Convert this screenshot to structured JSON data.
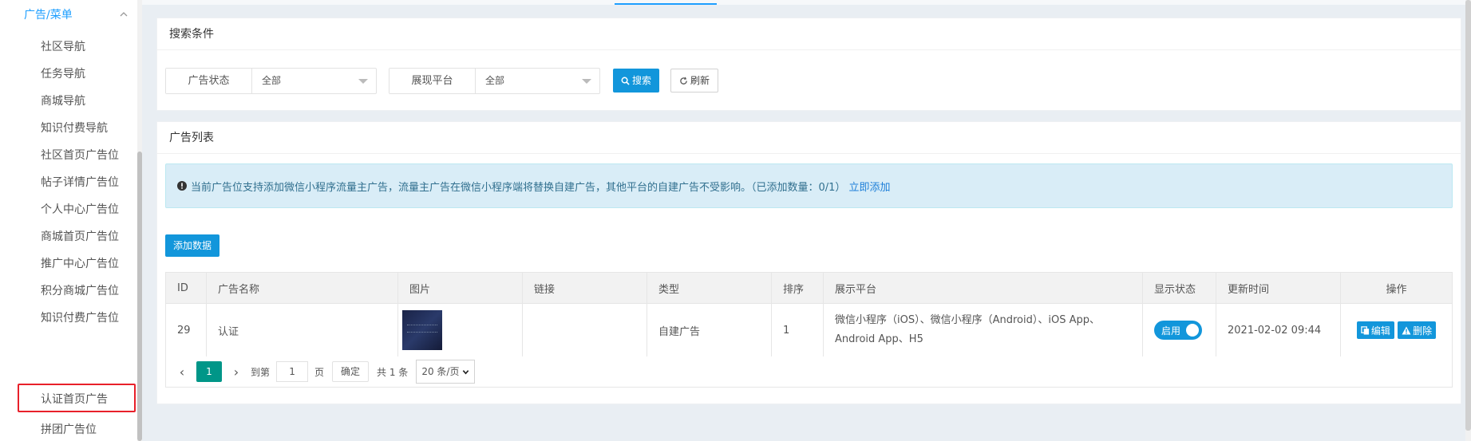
{
  "sidebar": {
    "group_title": "广告/菜单",
    "items": [
      {
        "label": "社区导航"
      },
      {
        "label": "任务导航"
      },
      {
        "label": "商城导航"
      },
      {
        "label": "知识付费导航"
      },
      {
        "label": "社区首页广告位"
      },
      {
        "label": "帖子详情广告位"
      },
      {
        "label": "个人中心广告位"
      },
      {
        "label": "商城首页广告位"
      },
      {
        "label": "推广中心广告位"
      },
      {
        "label": "积分商城广告位"
      },
      {
        "label": "知识付费广告位"
      },
      {
        "label": "认证首页广告"
      },
      {
        "label": "拼团广告位"
      }
    ],
    "highlighted_index": 11
  },
  "search": {
    "title": "搜索条件",
    "filter_status_label": "广告状态",
    "filter_status_value": "全部",
    "filter_platform_label": "展现平台",
    "filter_platform_value": "全部",
    "search_label": "搜索",
    "refresh_label": "刷新"
  },
  "list": {
    "title": "广告列表",
    "notice_text": "当前广告位支持添加微信小程序流量主广告，流量主广告在微信小程序端将替换自建广告，其他平台的自建广告不受影响。（已添加数量：0/1）",
    "notice_link": "立即添加",
    "add_label": "添加数据",
    "columns": [
      "ID",
      "广告名称",
      "图片",
      "链接",
      "类型",
      "排序",
      "展示平台",
      "显示状态",
      "更新时间",
      "操作"
    ],
    "rows": [
      {
        "id": "29",
        "name": "认证",
        "link": "",
        "type": "自建广告",
        "sort": "1",
        "platform_line1": "微信小程序（iOS）、微信小程序（Android）、iOS App、",
        "platform_line2": "Android App、H5",
        "status_label": "启用",
        "updated": "2021-02-02 09:44",
        "edit_label": "编辑",
        "delete_label": "删除"
      }
    ]
  },
  "pager": {
    "current_page": "1",
    "goto_label": "到第",
    "goto_value": "1",
    "page_unit": "页",
    "confirm_label": "确定",
    "total_label": "共 1 条",
    "page_size": "20 条/页"
  },
  "colors": {
    "accent": "#1296db",
    "link": "#1e9fff",
    "pager_active": "#009688",
    "highlight_border": "#e8202a"
  }
}
